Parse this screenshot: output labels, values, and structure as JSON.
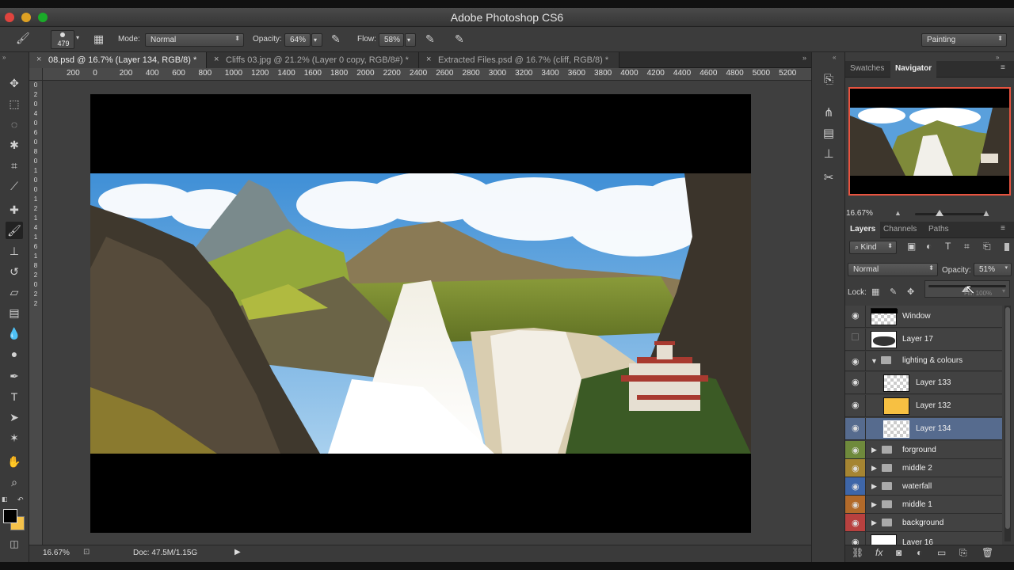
{
  "window": {
    "title": "Adobe Photoshop CS6"
  },
  "options": {
    "brush_size": "479",
    "mode_label": "Mode:",
    "mode_value": "Normal",
    "opacity_label": "Opacity:",
    "opacity_value": "64%",
    "flow_label": "Flow:",
    "flow_value": "58%",
    "workspace": "Painting"
  },
  "tabs": [
    {
      "label": "08.psd @ 16.7% (Layer 134, RGB/8) *"
    },
    {
      "label": "Cliffs 03.jpg @ 21.2% (Layer 0 copy, RGB/8#) *"
    },
    {
      "label": "Extracted Files.psd @ 16.7% (cliff, RGB/8) *"
    }
  ],
  "ruler": {
    "h_ticks": [
      "200",
      "0",
      "200",
      "400",
      "600",
      "800",
      "1000",
      "1200",
      "1400",
      "1600",
      "1800",
      "2000",
      "2200",
      "2400",
      "2600",
      "2800",
      "3000",
      "3200",
      "3400",
      "3600",
      "3800",
      "4000",
      "4200",
      "4400",
      "4600",
      "4800",
      "5000",
      "5200"
    ],
    "v_ticks": [
      "0",
      "2",
      "0",
      "4",
      "0",
      "6",
      "0",
      "8",
      "0",
      "1",
      "0",
      "0",
      "1",
      "2",
      "1",
      "4",
      "1",
      "6",
      "1",
      "8",
      "2",
      "0",
      "2",
      "2"
    ]
  },
  "status": {
    "zoom": "16.67%",
    "doc": "Doc: 47.5M/1.15G"
  },
  "navigator": {
    "tabs": [
      "Swatches",
      "Navigator"
    ],
    "zoom": "16.67%"
  },
  "layers_panel": {
    "tabs": [
      "Layers",
      "Channels",
      "Paths"
    ],
    "kind_label": "Kind",
    "blend_mode": "Normal",
    "opacity_label": "Opacity:",
    "opacity_value": "51%",
    "lock_label": "Lock:",
    "fill_hint": "Fill: 100%",
    "layers": [
      {
        "name": "Window",
        "visible": true,
        "type": "layer",
        "indent": 0
      },
      {
        "name": "Layer 17",
        "visible": false,
        "type": "layer",
        "indent": 0
      },
      {
        "name": "lighting & colours",
        "visible": true,
        "type": "group-open",
        "indent": 0
      },
      {
        "name": "Layer 133",
        "visible": true,
        "type": "layer",
        "indent": 1
      },
      {
        "name": "Layer 132",
        "visible": true,
        "type": "layer",
        "indent": 1
      },
      {
        "name": "Layer 134",
        "visible": true,
        "type": "layer",
        "indent": 1,
        "selected": true
      },
      {
        "name": "forground",
        "visible": true,
        "type": "group",
        "color": "#6f8a3c"
      },
      {
        "name": "middle 2",
        "visible": true,
        "type": "group",
        "color": "#a58532"
      },
      {
        "name": "waterfall",
        "visible": true,
        "type": "group",
        "color": "#3e66a8"
      },
      {
        "name": "middle 1",
        "visible": true,
        "type": "group",
        "color": "#b26a2a"
      },
      {
        "name": "background",
        "visible": true,
        "type": "group",
        "color": "#b8413f"
      },
      {
        "name": "Layer 16",
        "visible": true,
        "type": "layer",
        "indent": 0
      }
    ]
  }
}
